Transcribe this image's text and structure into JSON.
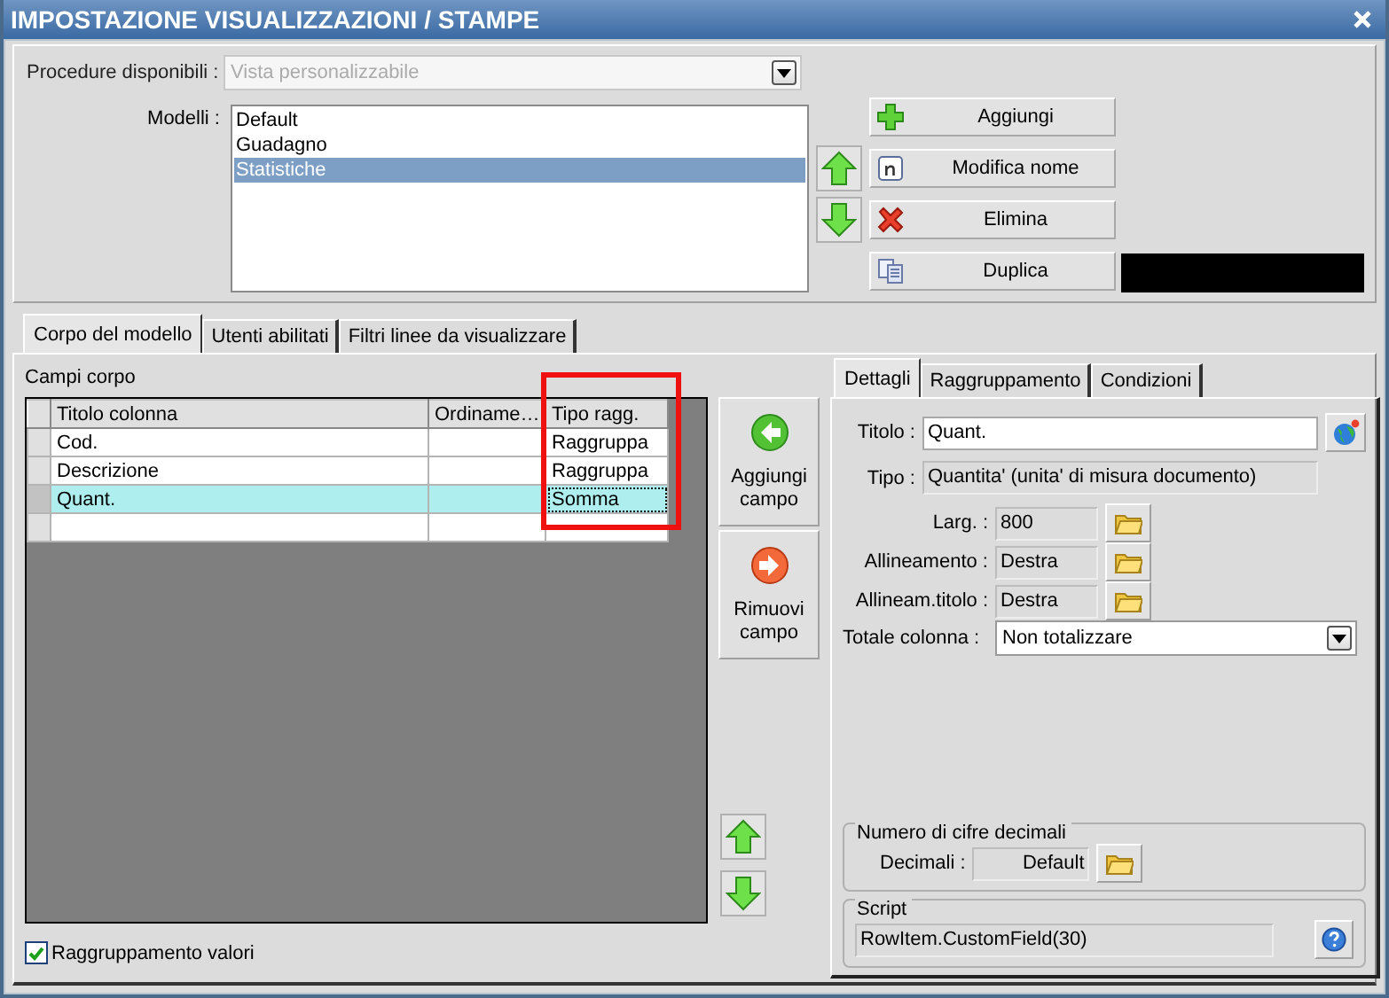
{
  "window": {
    "title": "IMPOSTAZIONE VISUALIZZAZIONI / STAMPE"
  },
  "procedure": {
    "label": "Procedure disponibili :",
    "value": "Vista personalizzabile",
    "disabled": true
  },
  "models": {
    "label": "Modelli :",
    "items": [
      {
        "label": "Default",
        "selected": false
      },
      {
        "label": "Guadagno",
        "selected": false
      },
      {
        "label": "Statistiche",
        "selected": true
      }
    ]
  },
  "model_buttons": [
    {
      "label": "Aggiungi"
    },
    {
      "label": "Modifica nome"
    },
    {
      "label": "Elimina"
    },
    {
      "label": "Duplica"
    }
  ],
  "tabs": [
    {
      "label": "Corpo del modello",
      "selected": true
    },
    {
      "label": "Utenti abilitati",
      "selected": false
    },
    {
      "label": "Filtri linee da visualizzare",
      "selected": false
    }
  ],
  "body_fields": {
    "title": "Campi corpo",
    "columns": [
      {
        "label": "Titolo colonna",
        "highlighted": false
      },
      {
        "label": "Ordiname…",
        "highlighted": false
      },
      {
        "label": "Tipo ragg.",
        "highlighted": true
      }
    ],
    "rows": [
      {
        "cells": [
          "Cod.",
          "",
          "Raggruppa"
        ],
        "selected": false
      },
      {
        "cells": [
          "Descrizione",
          "",
          "Raggruppa"
        ],
        "selected": false
      },
      {
        "cells": [
          "Quant.",
          "",
          "Somma"
        ],
        "selected": true
      },
      {
        "cells": [],
        "selected": false
      }
    ]
  },
  "field_buttons": [
    {
      "label": "Aggiungi campo"
    },
    {
      "label": "Rimuovi campo"
    }
  ],
  "grouping_values": {
    "label": "Raggruppamento valori",
    "checked": true
  },
  "detail_tabs": [
    {
      "label": "Dettagli",
      "selected": true
    },
    {
      "label": "Raggruppamento",
      "selected": false
    },
    {
      "label": "Condizioni",
      "selected": false
    }
  ],
  "details": {
    "titolo": {
      "label": "Titolo :",
      "value": "Quant."
    },
    "tipo": {
      "label": "Tipo :",
      "value": "Quantita' (unita' di misura documento)"
    },
    "options": [
      {
        "label": "Larg. :",
        "value": "800"
      },
      {
        "label": "Allineamento :",
        "value": "Destra"
      },
      {
        "label": "Allineam.titolo :",
        "value": "Destra"
      }
    ],
    "totale": {
      "label": "Totale colonna :",
      "value": "Non totalizzare"
    }
  },
  "decimals": {
    "legend": "Numero di cifre decimali",
    "label": "Decimali :",
    "value": "Default"
  },
  "script": {
    "legend": "Script",
    "value": "RowItem.CustomField(30)"
  }
}
